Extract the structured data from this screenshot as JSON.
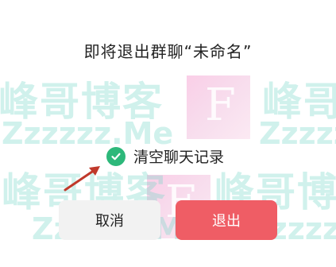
{
  "dialog": {
    "title": "即将退出群聊“未命名”",
    "option_label": "清空聊天记录",
    "option_checked": true,
    "cancel_label": "取消",
    "exit_label": "退出"
  },
  "watermark": {
    "brand": "峰哥博客",
    "site": "Zzzzzz.Me",
    "letter": "F"
  },
  "colors": {
    "check": "#2db87a",
    "exit_button": "#ef5d65",
    "cancel_button": "#f2f2f2",
    "arrow": "#c0392b"
  },
  "icons": {
    "check": "check-circle-icon",
    "arrow": "annotation-arrow-icon"
  }
}
